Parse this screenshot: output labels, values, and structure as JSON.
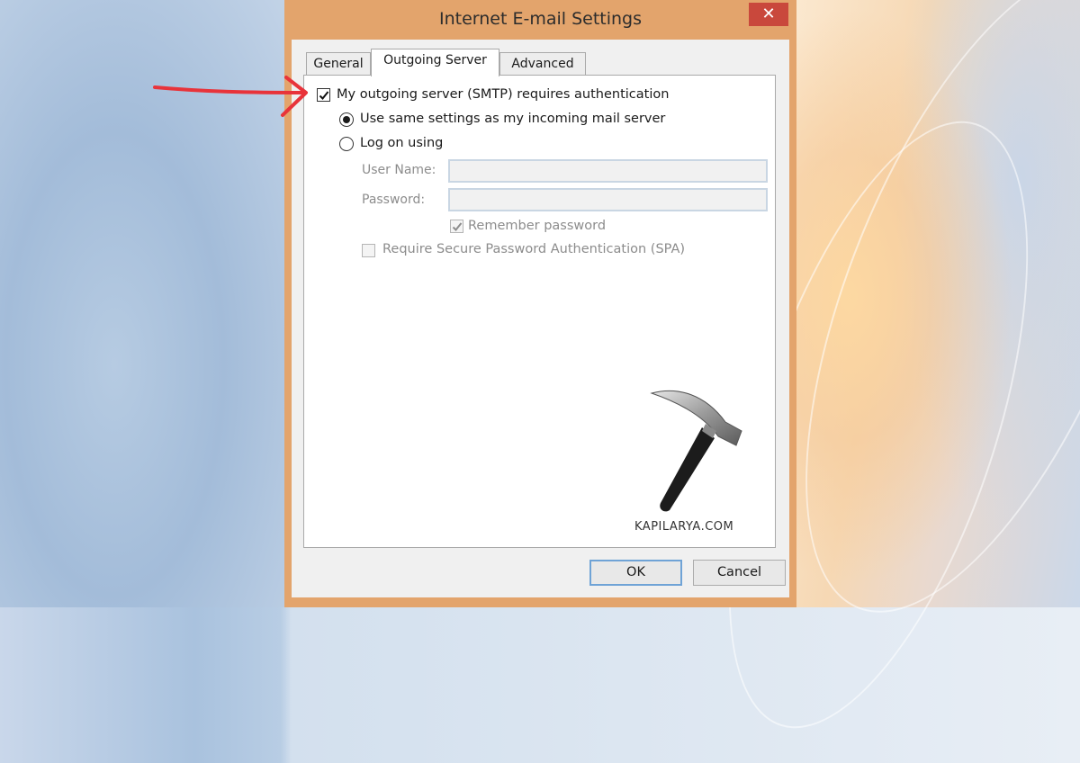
{
  "dialog": {
    "title": "Internet E-mail Settings",
    "close_glyph": "✕"
  },
  "tabs": [
    {
      "label": "General",
      "active": false
    },
    {
      "label": "Outgoing Server",
      "active": true
    },
    {
      "label": "Advanced",
      "active": false
    }
  ],
  "outgoing": {
    "requires_auth_label": "My outgoing server (SMTP) requires authentication",
    "requires_auth_checked": true,
    "use_same_label": "Use same settings as my incoming mail server",
    "use_same_selected": true,
    "log_on_label": "Log on using",
    "log_on_selected": false,
    "user_name_label": "User Name:",
    "user_name_value": "",
    "password_label": "Password:",
    "password_value": "",
    "remember_label": "Remember password",
    "remember_checked": true,
    "spa_label": "Require Secure Password Authentication (SPA)",
    "spa_checked": false
  },
  "buttons": {
    "ok": "OK",
    "cancel": "Cancel"
  },
  "watermark": {
    "text": "KAPILARYA.COM"
  },
  "colors": {
    "frame": "#e3a46c",
    "close": "#c9483c",
    "annotation_arrow": "#e8333a",
    "default_button_border": "#6fa3d6"
  }
}
